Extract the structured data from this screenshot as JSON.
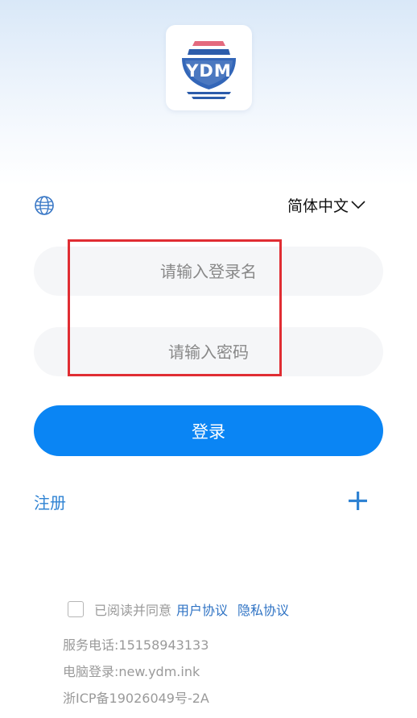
{
  "app": {
    "logo_text": "YDM"
  },
  "language": {
    "globe_icon": "globe-icon",
    "selected": "简体中文",
    "chevron_icon": "chevron-down-icon"
  },
  "login_form": {
    "username_placeholder": "请输入登录名",
    "username_value": "",
    "password_placeholder": "请输入密码",
    "password_value": "",
    "login_label": "登录"
  },
  "register": {
    "label": "注册",
    "add_icon": "plus-icon"
  },
  "agreement": {
    "checked": false,
    "text": "已阅读并同意",
    "user_agreement": "用户协议",
    "privacy_policy": "隐私协议"
  },
  "footer": {
    "service_phone": "服务电话:15158943133",
    "pc_login": "电脑登录:new.ydm.ink",
    "icp": "浙ICP备19026049号-2A"
  },
  "colors": {
    "primary": "#0a85f4",
    "link": "#2f83d3",
    "highlight_border": "#e02d33",
    "input_bg": "#f5f6f8"
  }
}
